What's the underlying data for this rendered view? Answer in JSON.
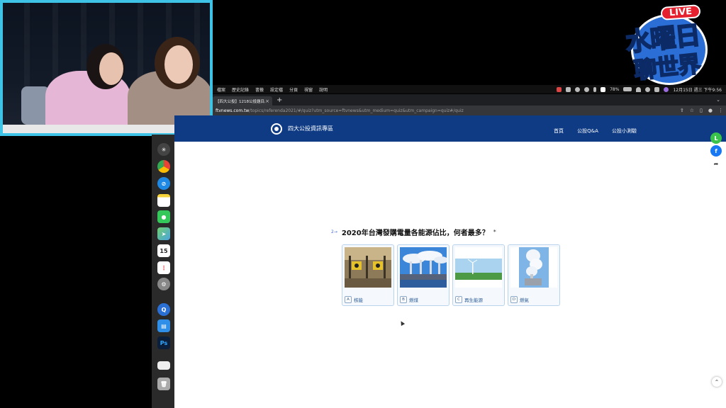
{
  "broadcast": {
    "logo": {
      "live": "LIVE",
      "line1": "水曜日",
      "line2": "聊世界"
    }
  },
  "menubar": {
    "items": [
      "檔案",
      "歷史記錄",
      "書籤",
      "設定檔",
      "分頁",
      "視窗",
      "說明"
    ],
    "battery": "78%",
    "clock": "12月15日 週三 下午9:56"
  },
  "browser": {
    "tab_title": "【四大公投】1218公投題目。戰",
    "tab_close": "×",
    "new_tab": "+",
    "url_host": "ftvnews.com.tw",
    "url_path": "/topics/referenda2021/#/quiz?utm_source=ftvnews&utm_medium=quiz&utm_campaign=quiz#/quiz"
  },
  "dock": {
    "calendar_day": "15",
    "ps_label": "Ps"
  },
  "site": {
    "title": "四大公投資訊專區",
    "nav": [
      "首頁",
      "公投Q&A",
      "公投小測驗"
    ]
  },
  "quiz": {
    "number": "2→",
    "question": "2020年台灣發購電量各能源佔比，何者最多？",
    "required": "*",
    "options": [
      {
        "key": "A",
        "label": "核能",
        "image": "nuclear-plant"
      },
      {
        "key": "B",
        "label": "燃煤",
        "image": "coal-plant"
      },
      {
        "key": "C",
        "label": "再生能源",
        "image": "wind-turbine"
      },
      {
        "key": "D",
        "label": "燃氣",
        "image": "gas-plant"
      }
    ]
  },
  "share_buttons": [
    {
      "icon": "line-icon",
      "color": "#3ac34a"
    },
    {
      "icon": "facebook-icon",
      "color": "#1877f2"
    },
    {
      "icon": "share-arrow-icon",
      "color": "#ffffff"
    }
  ]
}
